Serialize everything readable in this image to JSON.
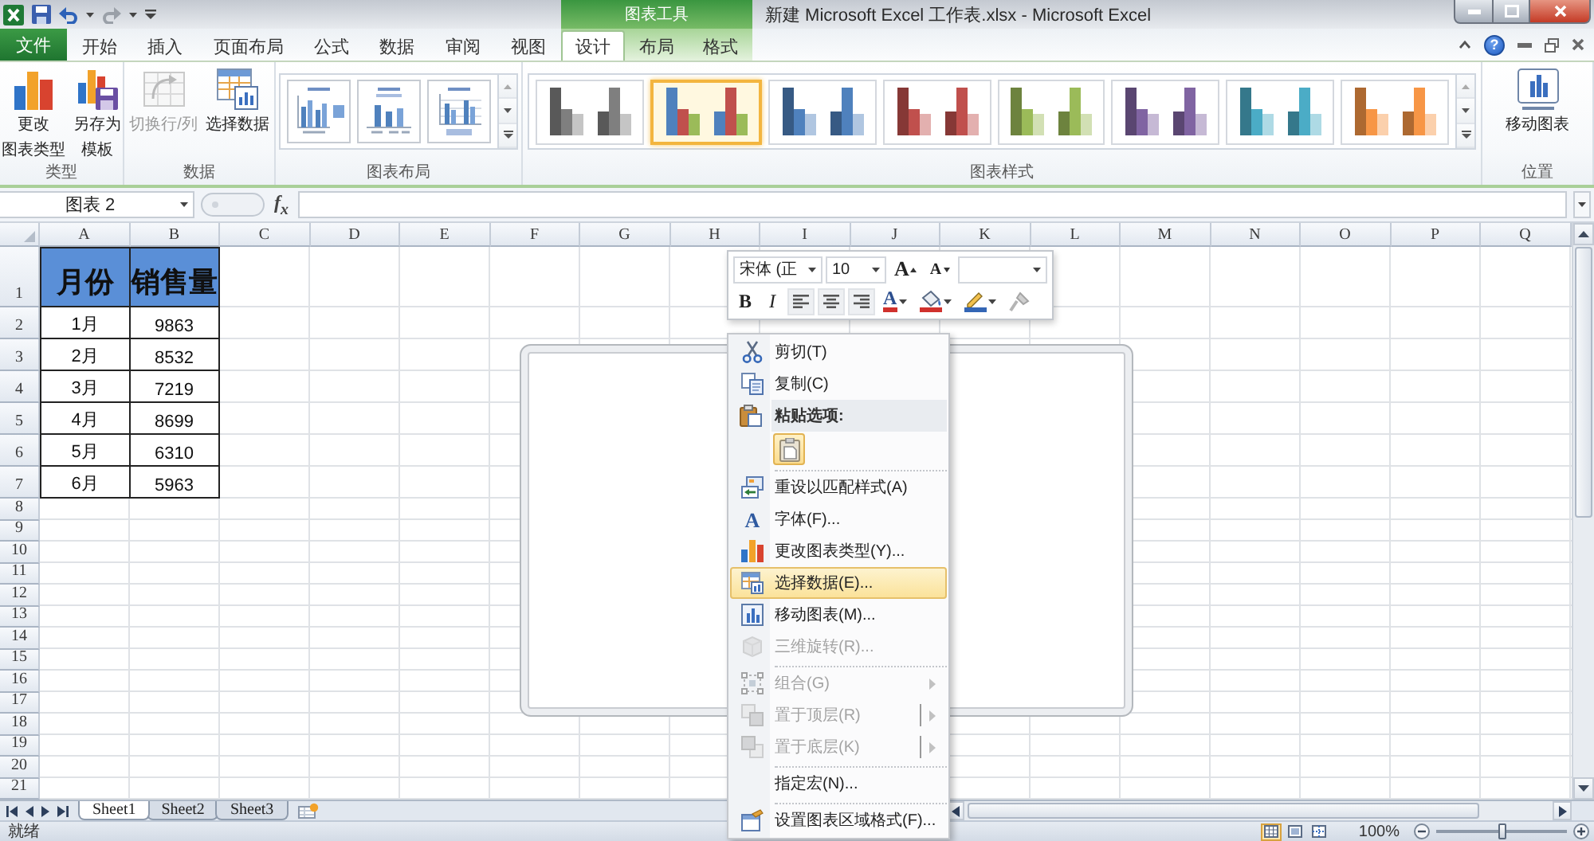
{
  "title_bar": {
    "quick_access": [
      {
        "disabled": false
      },
      {
        "disabled": false
      },
      {
        "disabled": true
      }
    ],
    "tool_group": "图表工具",
    "title": "新建 Microsoft Excel 工作表.xlsx - Microsoft Excel"
  },
  "tabs": [
    {
      "label": "文件",
      "kind": "file",
      "selected": false
    },
    {
      "label": "开始",
      "kind": "main",
      "selected": false
    },
    {
      "label": "插入",
      "kind": "main",
      "selected": false
    },
    {
      "label": "页面布局",
      "kind": "main",
      "selected": false
    },
    {
      "label": "公式",
      "kind": "main",
      "selected": false
    },
    {
      "label": "数据",
      "kind": "main",
      "selected": false
    },
    {
      "label": "审阅",
      "kind": "main",
      "selected": false
    },
    {
      "label": "视图",
      "kind": "main",
      "selected": false
    },
    {
      "label": "设计",
      "kind": "tool",
      "selected": true
    },
    {
      "label": "布局",
      "kind": "tool",
      "selected": false
    },
    {
      "label": "格式",
      "kind": "tool",
      "selected": false
    }
  ],
  "help": "?",
  "ribbon": {
    "groups": [
      {
        "label": "类型",
        "kind": "buttons",
        "buttons": [
          {
            "lines": [
              "更改",
              "图表类型"
            ],
            "disabled": false
          },
          {
            "lines": [
              "另存为",
              "模板"
            ],
            "disabled": false
          }
        ]
      },
      {
        "label": "数据",
        "kind": "buttons",
        "buttons": [
          {
            "lines": [
              "切换行/列"
            ],
            "disabled": true
          },
          {
            "lines": [
              "选择数据"
            ],
            "disabled": false
          }
        ]
      },
      {
        "label": "图表布局",
        "kind": "layouts",
        "items": [
          {
            "selected": false
          },
          {
            "selected": false
          },
          {
            "selected": false
          }
        ]
      },
      {
        "label": "图表样式",
        "kind": "styles",
        "items": [
          {
            "kind": "mono",
            "color": "#7f7f7f",
            "selected": false
          },
          {
            "kind": "multi",
            "selected": true
          },
          {
            "kind": "mono",
            "color": "#4f81bd",
            "selected": false
          },
          {
            "kind": "mono",
            "color": "#c0504d",
            "selected": false
          },
          {
            "kind": "mono",
            "color": "#9bbb59",
            "selected": false
          },
          {
            "kind": "mono",
            "color": "#8064a2",
            "selected": false
          },
          {
            "kind": "mono",
            "color": "#4bacc6",
            "selected": false
          },
          {
            "kind": "mono",
            "color": "#f79646",
            "selected": false
          }
        ]
      },
      {
        "label": "位置",
        "kind": "buttons",
        "buttons": [
          {
            "lines": [
              "移动图表"
            ],
            "disabled": false
          }
        ]
      }
    ]
  },
  "formula_bar": {
    "name_box": "图表 2",
    "function_button": "f$_{x}$"
  },
  "sheet": {
    "columns": [
      "A",
      "B",
      "C",
      "D",
      "E",
      "F",
      "G",
      "H",
      "I",
      "J",
      "K",
      "L",
      "M",
      "N",
      "O",
      "P",
      "Q"
    ],
    "rows": [
      "1",
      "2",
      "3",
      "4",
      "5",
      "6",
      "7",
      "8",
      "9",
      "10",
      "11",
      "12",
      "13",
      "14",
      "15",
      "16",
      "17",
      "18",
      "19",
      "20",
      "21"
    ],
    "table": {
      "header": [
        "月份",
        "销售量"
      ],
      "rows": [
        [
          "1月",
          "9863"
        ],
        [
          "2月",
          "8532"
        ],
        [
          "3月",
          "7219"
        ],
        [
          "4月",
          "8699"
        ],
        [
          "5月",
          "6310"
        ],
        [
          "6月",
          "5963"
        ]
      ]
    }
  },
  "mini_toolbar": {
    "font": "宋体 (正",
    "size": "10",
    "grow_font": "A",
    "shrink_font": "A",
    "bold": "B",
    "italic": "I",
    "font_color": "A"
  },
  "context_menu": {
    "sections": [
      [
        {
          "kind": "item",
          "label": "剪切(T)",
          "selected": false,
          "disabled": false,
          "submenu": false,
          "split": false
        },
        {
          "kind": "item",
          "label": "复制(C)",
          "selected": false,
          "disabled": false,
          "submenu": false,
          "split": false
        },
        {
          "kind": "header",
          "label": "粘贴选项:"
        },
        {
          "kind": "paste_option"
        }
      ],
      [
        {
          "kind": "item",
          "label": "重设以匹配样式(A)",
          "selected": false,
          "disabled": false,
          "submenu": false,
          "split": false
        },
        {
          "kind": "item",
          "label": "字体(F)...",
          "icon_text": "A",
          "selected": false,
          "disabled": false,
          "submenu": false,
          "split": false
        },
        {
          "kind": "item",
          "label": "更改图表类型(Y)...",
          "selected": false,
          "disabled": false,
          "submenu": false,
          "split": false
        },
        {
          "kind": "item",
          "label": "选择数据(E)...",
          "selected": true,
          "disabled": false,
          "submenu": false,
          "split": false
        },
        {
          "kind": "item",
          "label": "移动图表(M)...",
          "selected": false,
          "disabled": false,
          "submenu": false,
          "split": false
        },
        {
          "kind": "item",
          "label": "三维旋转(R)...",
          "selected": false,
          "disabled": true,
          "submenu": false,
          "split": false
        }
      ],
      [
        {
          "kind": "item",
          "label": "组合(G)",
          "selected": false,
          "disabled": true,
          "submenu": true,
          "split": false
        },
        {
          "kind": "item",
          "label": "置于顶层(R)",
          "selected": false,
          "disabled": true,
          "submenu": true,
          "split": true
        },
        {
          "kind": "item",
          "label": "置于底层(K)",
          "selected": false,
          "disabled": true,
          "submenu": true,
          "split": true
        }
      ],
      [
        {
          "kind": "item",
          "label": "指定宏(N)...",
          "selected": false,
          "disabled": false,
          "submenu": false,
          "split": false
        }
      ],
      [
        {
          "kind": "item",
          "label": "设置图表区域格式(F)...",
          "selected": false,
          "disabled": false,
          "submenu": false,
          "split": false
        }
      ]
    ]
  },
  "sheet_tabs": [
    {
      "label": "Sheet1",
      "selected": true
    },
    {
      "label": "Sheet2",
      "selected": false
    },
    {
      "label": "Sheet3",
      "selected": false
    }
  ],
  "status_bar": {
    "status": "就绪",
    "views": [
      {
        "selected": true
      },
      {
        "selected": false
      },
      {
        "selected": false
      }
    ],
    "zoom": "100%",
    "zoom_slider": {
      "level": 0.5
    }
  }
}
